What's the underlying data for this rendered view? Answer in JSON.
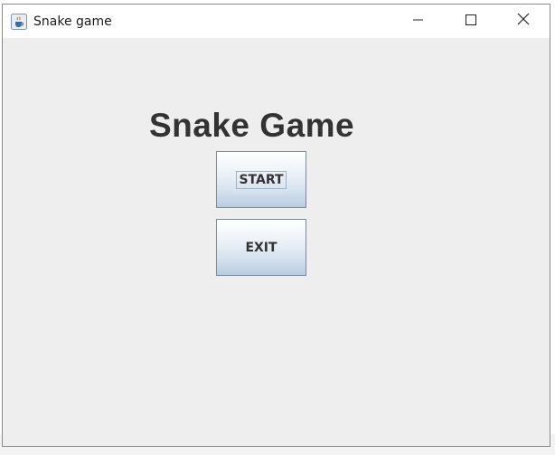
{
  "window": {
    "title": "Snake game",
    "app_icon": "java-cup-icon",
    "controls": [
      "minimize-icon",
      "maximize-icon",
      "close-icon"
    ]
  },
  "menu": {
    "heading": "Snake Game",
    "start_label": "START",
    "exit_label": "EXIT"
  },
  "colors": {
    "window_bg": "#eeeeee",
    "heading": "#333333",
    "button_border": "#7a8a9c"
  }
}
